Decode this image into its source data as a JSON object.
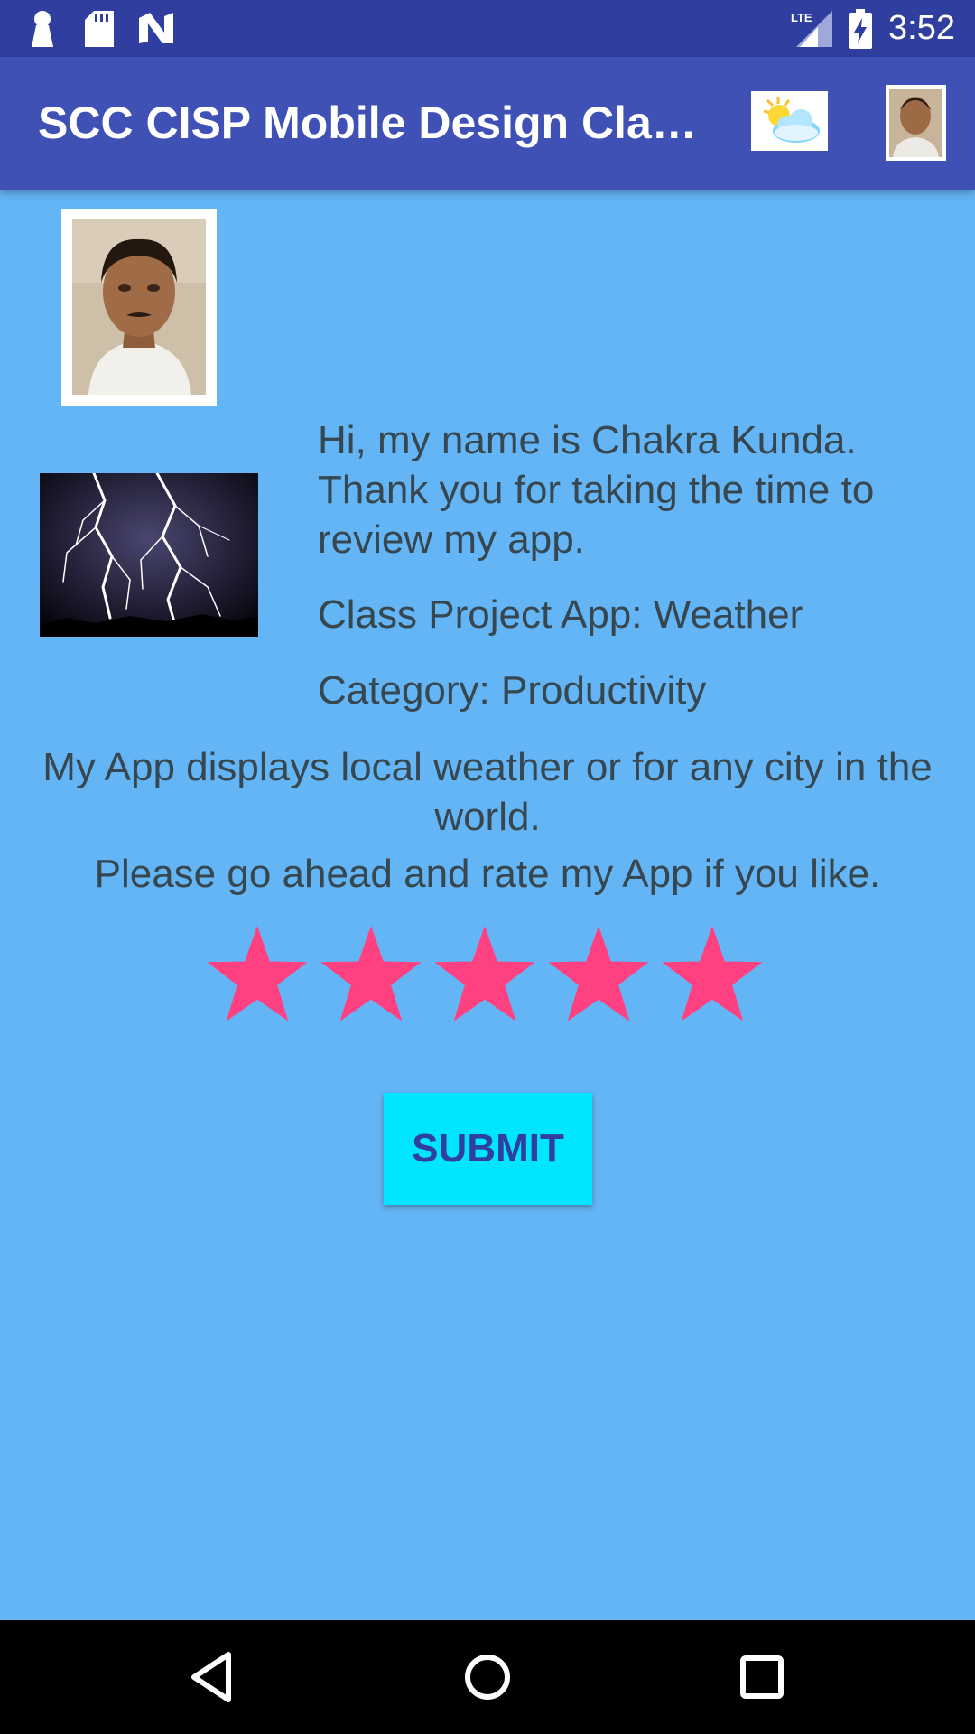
{
  "status_bar": {
    "icons": [
      "keyhole-icon",
      "sd-card-icon",
      "n-logo-icon",
      "lte-signal-icon",
      "battery-charging-icon"
    ],
    "network_label": "LTE",
    "time": "3:52"
  },
  "app_bar": {
    "title": "SCC CISP Mobile Design Class Project",
    "actions": [
      "weather-icon",
      "profile-photo-icon"
    ]
  },
  "content": {
    "profile_image": "profile-photo",
    "feature_image": "lightning-photo",
    "intro": "Hi, my name is Chakra Kunda. Thank you for taking the time to review my app.",
    "project": "Class Project App: Weather",
    "category": "Category: Productivity",
    "description": "My App displays local weather or for any city in the world.",
    "rate_prompt": "Please go ahead and rate my App if you like."
  },
  "rating": {
    "value": 5,
    "max": 5,
    "star_color": "#ff4081"
  },
  "submit_label": "SUBMIT",
  "colors": {
    "background": "#64b5f6",
    "app_bar": "#3f51b5",
    "status_bar": "#303f9f",
    "button": "#00e5ff",
    "button_text": "#303f9f"
  },
  "nav_bar": {
    "buttons": [
      "back-icon",
      "home-icon",
      "recents-icon"
    ]
  }
}
